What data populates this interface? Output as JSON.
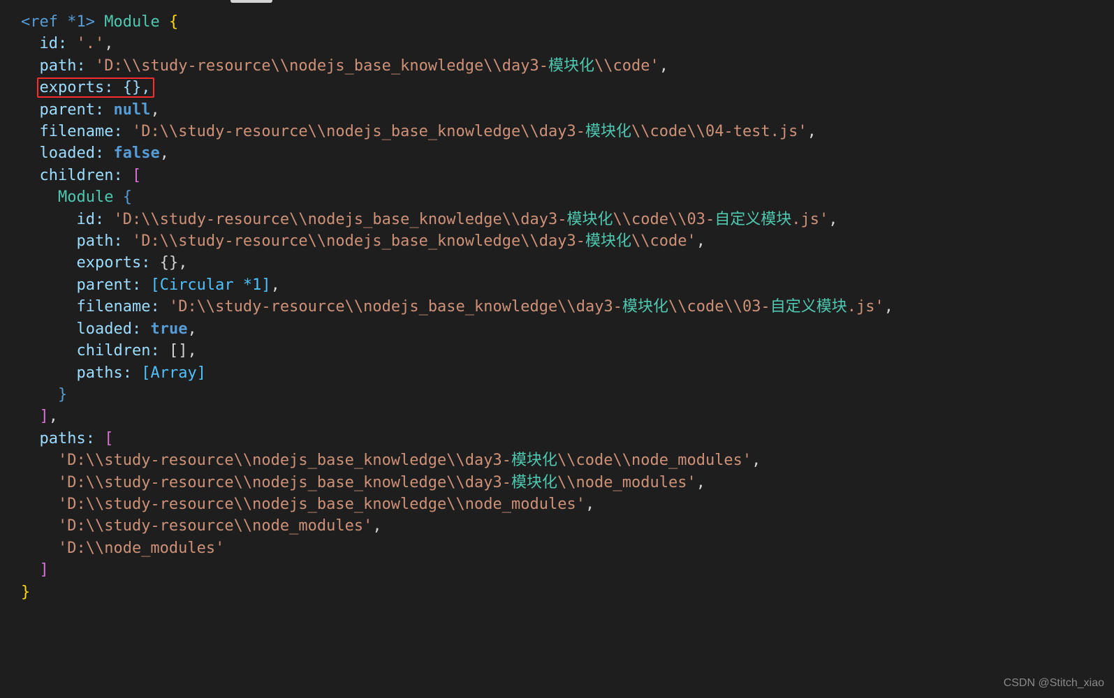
{
  "ref_marker": "<ref *1>",
  "type_name": "Module",
  "module": {
    "id": "'.'",
    "path_prefix": "'D:\\\\study-resource\\\\nodejs_base_knowledge\\\\day3-",
    "path_cjk": "模块化",
    "path_suffix": "\\\\code'",
    "exports_line": "exports: {},",
    "parent_label": "parent:",
    "parent_value": "null",
    "filename_prefix": "'D:\\\\study-resource\\\\nodejs_base_knowledge\\\\day3-",
    "filename_cjk": "模块化",
    "filename_suffix": "\\\\code\\\\04-test.js'",
    "loaded_label": "loaded:",
    "loaded_value": "false",
    "children_label": "children:",
    "paths_label": "paths:"
  },
  "child": {
    "type_name": "Module",
    "id_prefix": "'D:\\\\study-resource\\\\nodejs_base_knowledge\\\\day3-",
    "id_cjk1": "模块化",
    "id_mid": "\\\\code\\\\03-",
    "id_cjk2": "自定义模块",
    "id_suffix": ".js'",
    "path_prefix": "'D:\\\\study-resource\\\\nodejs_base_knowledge\\\\day3-",
    "path_cjk": "模块化",
    "path_suffix": "\\\\code'",
    "exports_label": "exports:",
    "exports_value": "{}",
    "parent_label": "parent:",
    "circular": "[Circular *1]",
    "filename_prefix": "'D:\\\\study-resource\\\\nodejs_base_knowledge\\\\day3-",
    "filename_cjk1": "模块化",
    "filename_mid": "\\\\code\\\\03-",
    "filename_cjk2": "自定义模块",
    "filename_suffix": ".js'",
    "loaded_label": "loaded:",
    "loaded_value": "true",
    "children_label": "children:",
    "children_value": "[]",
    "paths_label": "paths:",
    "paths_value": "[Array]"
  },
  "paths": {
    "p0_prefix": "'D:\\\\study-resource\\\\nodejs_base_knowledge\\\\day3-",
    "p0_cjk": "模块化",
    "p0_suffix": "\\\\code\\\\node_modules'",
    "p1_prefix": "'D:\\\\study-resource\\\\nodejs_base_knowledge\\\\day3-",
    "p1_cjk": "模块化",
    "p1_suffix": "\\\\node_modules'",
    "p2": "'D:\\\\study-resource\\\\nodejs_base_knowledge\\\\node_modules'",
    "p3": "'D:\\\\study-resource\\\\node_modules'",
    "p4": "'D:\\\\node_modules'"
  },
  "watermark": "CSDN @Stitch_xiao",
  "labels": {
    "id": "id:",
    "path": "path:",
    "filename": "filename:"
  }
}
